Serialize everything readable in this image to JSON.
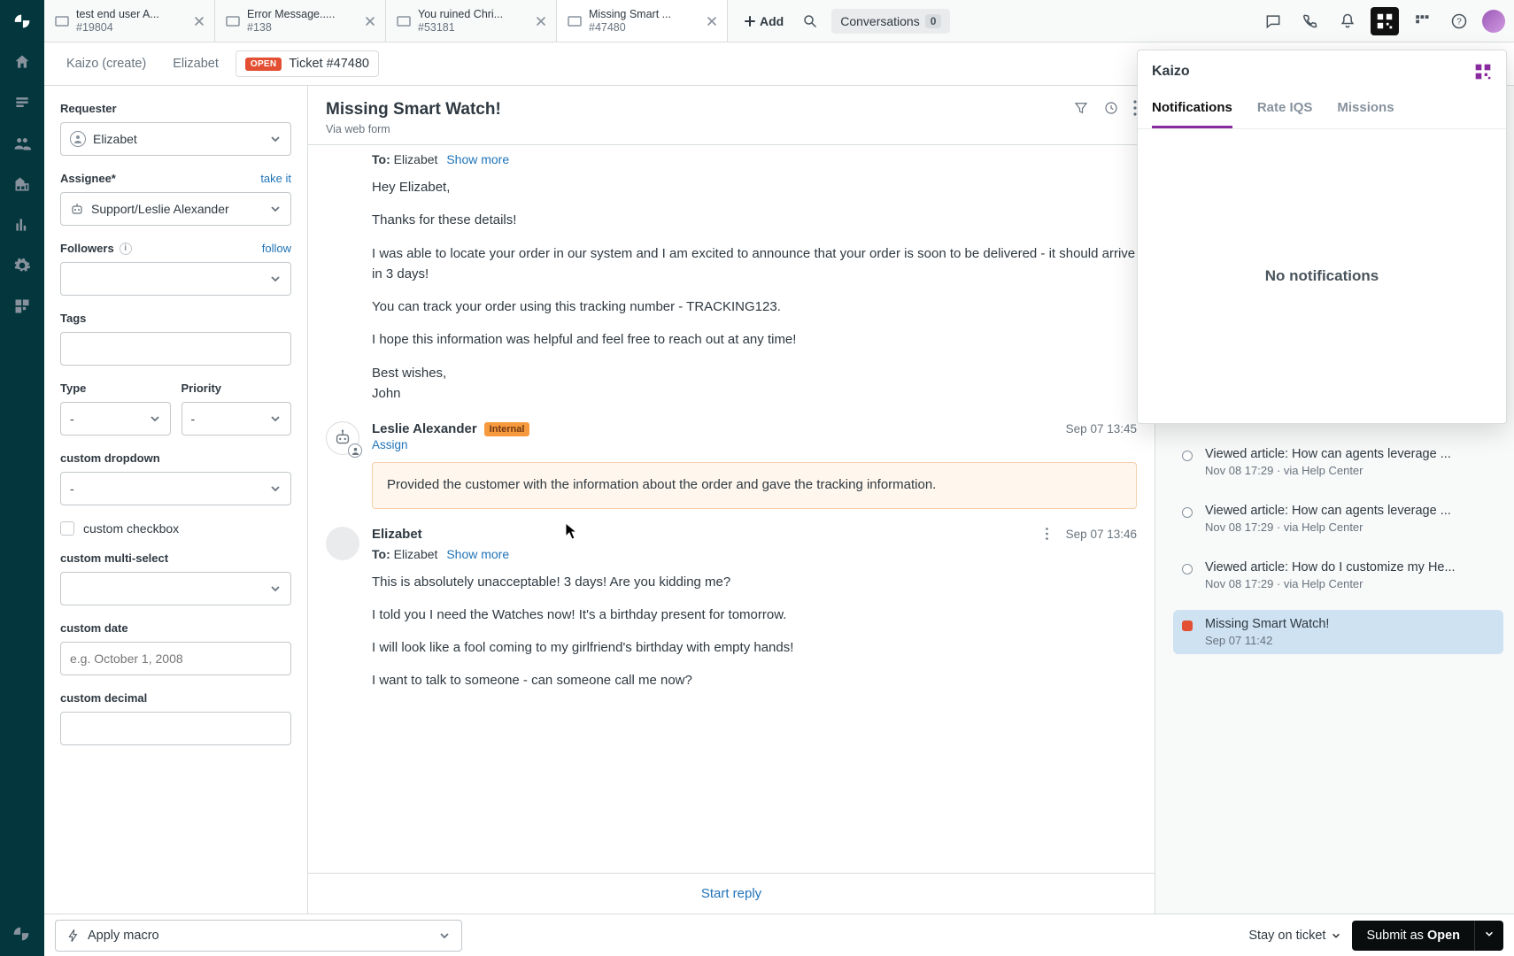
{
  "tabs": [
    {
      "title": "test end user A...",
      "num": "#19804"
    },
    {
      "title": "Error Message.....",
      "num": "#138"
    },
    {
      "title": "You ruined Chri...",
      "num": "#53181"
    },
    {
      "title": "Missing Smart ...",
      "num": "#47480"
    }
  ],
  "top": {
    "add": "Add",
    "conversations": "Conversations",
    "conv_count": "0"
  },
  "breadcrumb": {
    "c1": "Kaizo (create)",
    "c2": "Elizabet",
    "open": "OPEN",
    "ticket": "Ticket #47480"
  },
  "sidebar": {
    "requester_label": "Requester",
    "requester_value": "Elizabet",
    "assignee_label": "Assignee*",
    "take_it": "take it",
    "assignee_value": "Support/Leslie Alexander",
    "followers_label": "Followers",
    "follow": "follow",
    "tags_label": "Tags",
    "type_label": "Type",
    "type_value": "-",
    "priority_label": "Priority",
    "priority_value": "-",
    "custom_dropdown_label": "custom dropdown",
    "custom_dropdown_value": "-",
    "custom_checkbox_label": "custom checkbox",
    "custom_multi_label": "custom multi-select",
    "custom_date_label": "custom date",
    "custom_date_placeholder": "e.g. October 1, 2008",
    "custom_decimal_label": "custom decimal"
  },
  "main": {
    "title": "Missing Smart Watch!",
    "via": "Via web form",
    "to_label": "To:",
    "to_value": "Elizabet",
    "show_more": "Show more",
    "msg1": {
      "p1": "Hey Elizabet,",
      "p2": "Thanks for these details!",
      "p3": "I was able to locate your order in our system and I am excited to announce that your order is soon to be delivered - it should arrive in 3 days!",
      "p4": "You can track your order using this tracking number - TRACKING123.",
      "p5": "I hope this information was helpful and feel free to reach out at any time!",
      "p6": "Best wishes,",
      "p7": "John"
    },
    "internal": {
      "name": "Leslie Alexander",
      "badge": "Internal",
      "assign": "Assign",
      "time": "Sep 07 13:45",
      "note": "Provided the customer with the information about the order and gave the tracking information."
    },
    "reply": {
      "name": "Elizabet",
      "time": "Sep 07 13:46",
      "to_value": "Elizabet",
      "p1": "This is absolutely unacceptable! 3 days! Are you kidding me?",
      "p2": "I told you I need the Watches now! It's a birthday present for tomorrow.",
      "p3": "I will look like a fool coming to my girlfriend's birthday with empty hands!",
      "p4": "I want to talk to someone - can someone call me now?"
    },
    "start_reply": "Start reply"
  },
  "timeline": [
    {
      "title": "Viewed article: How can agents leverage ...",
      "meta": "Nov 08 17:29 · via Help Center",
      "kind": "dot"
    },
    {
      "title": "Viewed article: How can agents leverage ...",
      "meta": "Nov 08 17:29 · via Help Center",
      "kind": "dot"
    },
    {
      "title": "Viewed article: How do I customize my He...",
      "meta": "Nov 08 17:29 · via Help Center",
      "kind": "dot"
    },
    {
      "title": "Missing Smart Watch!",
      "meta": "Sep 07 11:42",
      "kind": "open",
      "active": true
    }
  ],
  "kaizo": {
    "title": "Kaizo",
    "tabs": {
      "notifications": "Notifications",
      "rate": "Rate IQS",
      "missions": "Missions"
    },
    "empty": "No notifications"
  },
  "footer": {
    "macro": "Apply macro",
    "stay": "Stay on ticket",
    "submit_prefix": "Submit as ",
    "submit_status": "Open"
  }
}
